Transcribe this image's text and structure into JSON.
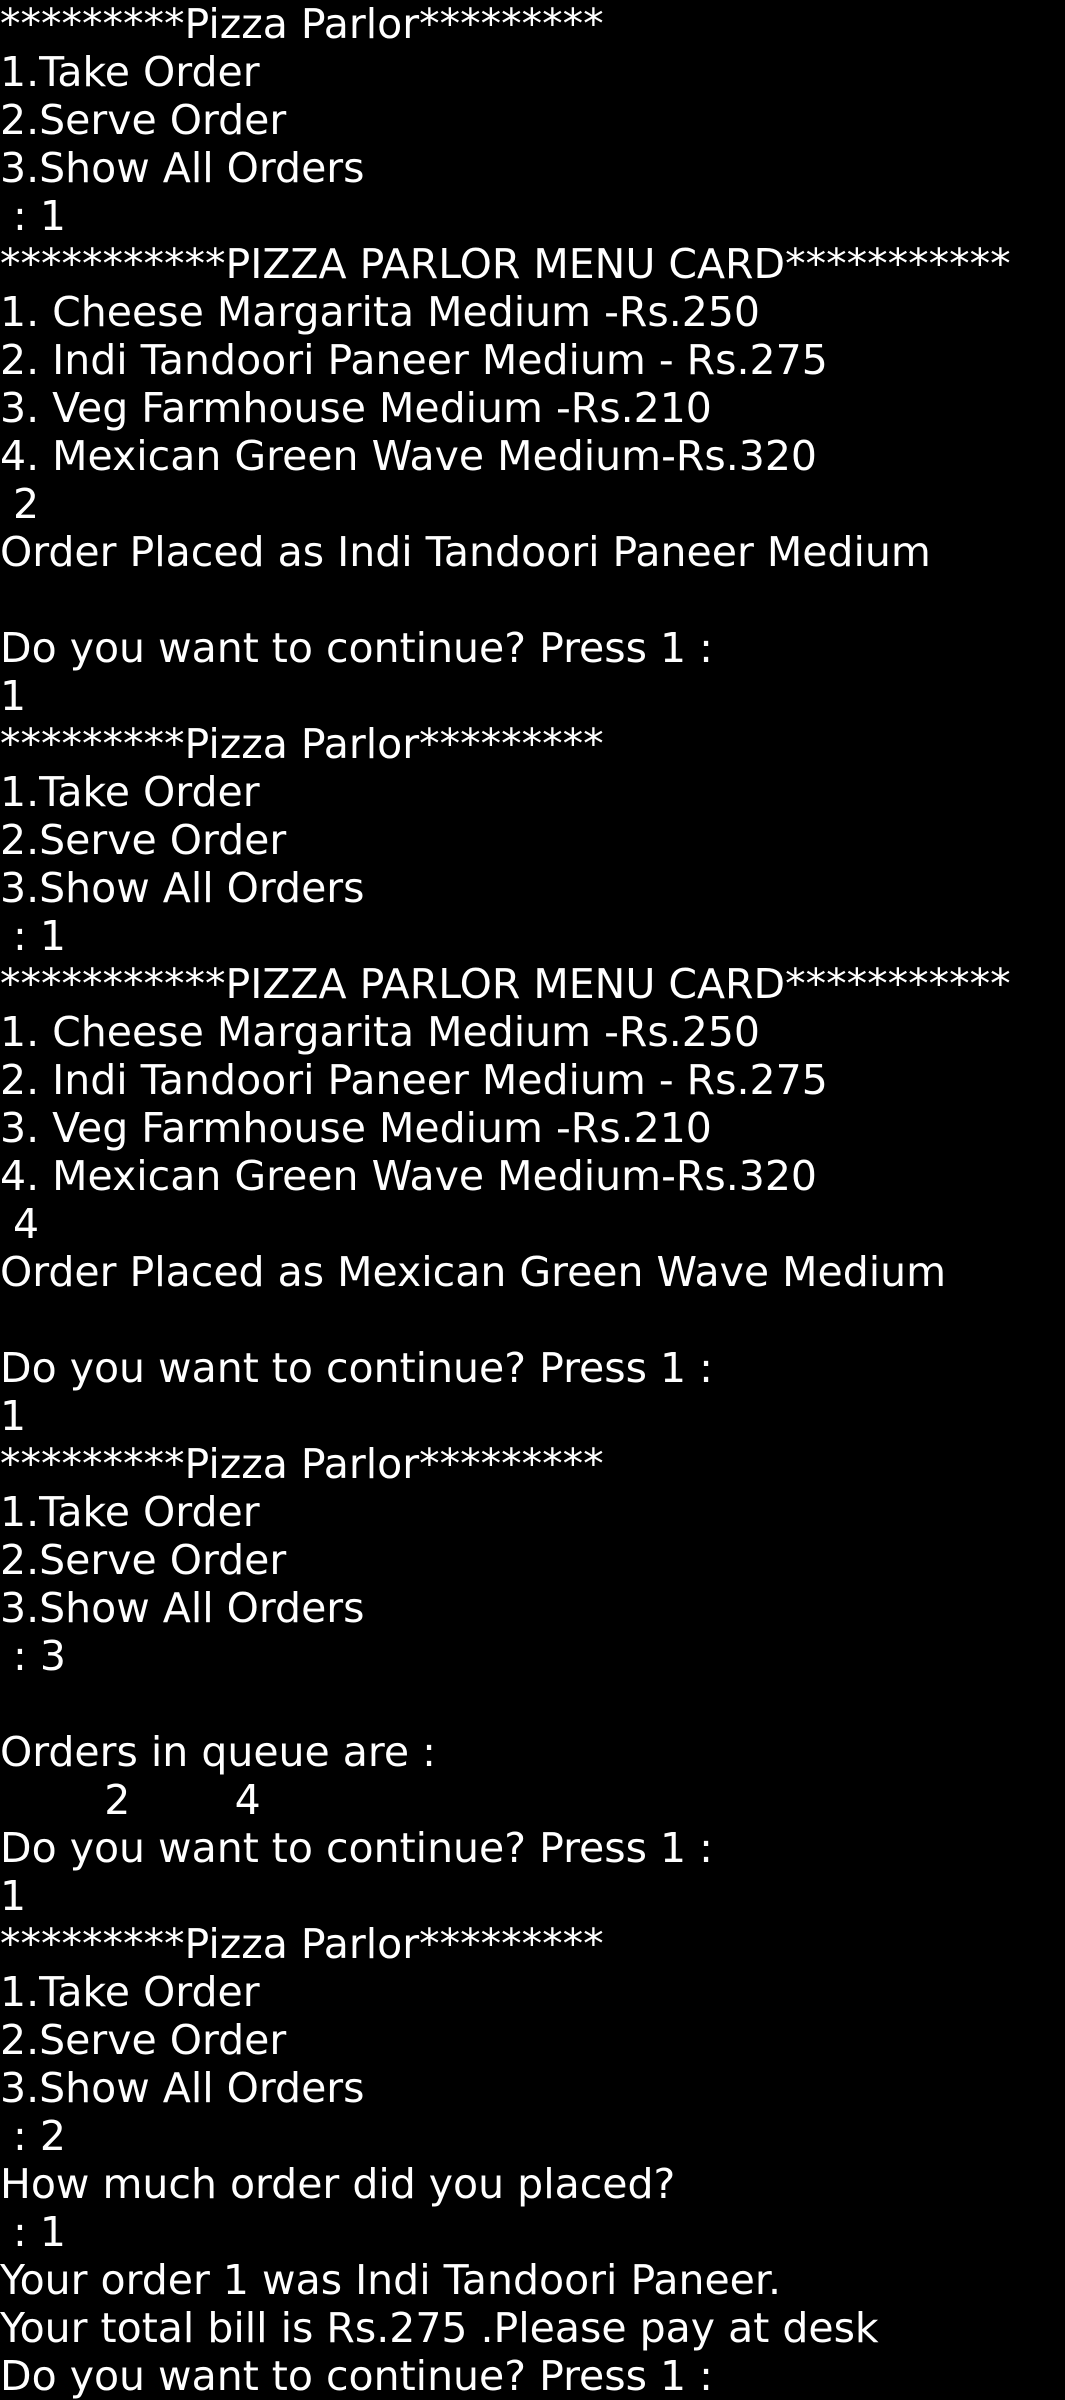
{
  "colors": {
    "background": "#000000",
    "text": "#ffffff"
  },
  "terminal": {
    "lines": [
      "*********Pizza Parlor*********",
      "1.Take Order",
      "2.Serve Order",
      "3.Show All Orders",
      " : 1",
      "***********PIZZA PARLOR MENU CARD***********",
      "1. Cheese Margarita Medium -Rs.250",
      "2. Indi Tandoori Paneer Medium - Rs.275",
      "3. Veg Farmhouse Medium -Rs.210",
      "4. Mexican Green Wave Medium-Rs.320",
      " 2",
      "Order Placed as Indi Tandoori Paneer Medium",
      "",
      "Do you want to continue? Press 1 :",
      "1",
      "*********Pizza Parlor*********",
      "1.Take Order",
      "2.Serve Order",
      "3.Show All Orders",
      " : 1",
      "***********PIZZA PARLOR MENU CARD***********",
      "1. Cheese Margarita Medium -Rs.250",
      "2. Indi Tandoori Paneer Medium - Rs.275",
      "3. Veg Farmhouse Medium -Rs.210",
      "4. Mexican Green Wave Medium-Rs.320",
      " 4",
      "Order Placed as Mexican Green Wave Medium",
      "",
      "Do you want to continue? Press 1 :",
      "1",
      "*********Pizza Parlor*********",
      "1.Take Order",
      "2.Serve Order",
      "3.Show All Orders",
      " : 3",
      "",
      "Orders in queue are :",
      "        2        4",
      "Do you want to continue? Press 1 :",
      "1",
      "*********Pizza Parlor*********",
      "1.Take Order",
      "2.Serve Order",
      "3.Show All Orders",
      " : 2",
      "How much order did you placed?",
      " : 1",
      "Your order 1 was Indi Tandoori Paneer.",
      "Your total bill is Rs.275 .Please pay at desk",
      "Do you want to continue? Press 1 :"
    ]
  }
}
